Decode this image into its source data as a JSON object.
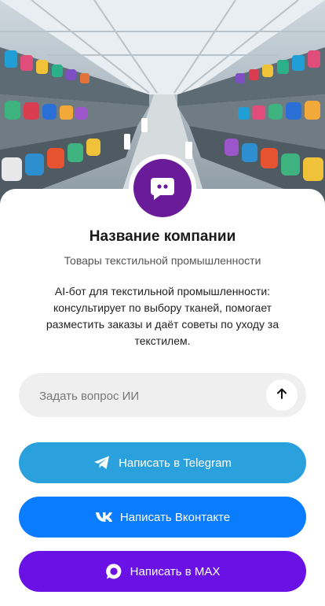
{
  "company": {
    "name": "Название компании",
    "subtitle": "Товары текстильной промышленности",
    "description": "AI-бот для текстильной промышленности: консультирует по выбору тканей, помогает разместить заказы и даёт советы по уходу за текстилем."
  },
  "ask": {
    "placeholder": "Задать вопрос ИИ"
  },
  "buttons": {
    "telegram": "Написать в Telegram",
    "vk": "Написать Вконтакте",
    "max": "Написать в MAX"
  },
  "colors": {
    "avatar": "#6a1b9a",
    "telegram": "#2aa0dd",
    "vk": "#0a7cff",
    "max": "#6a12e6",
    "input_bg": "#efefef"
  },
  "icons": {
    "avatar": "chat-bot-icon",
    "send": "arrow-up-icon",
    "telegram": "telegram-plane-icon",
    "vk": "vk-logo-icon",
    "max": "max-chat-icon"
  }
}
